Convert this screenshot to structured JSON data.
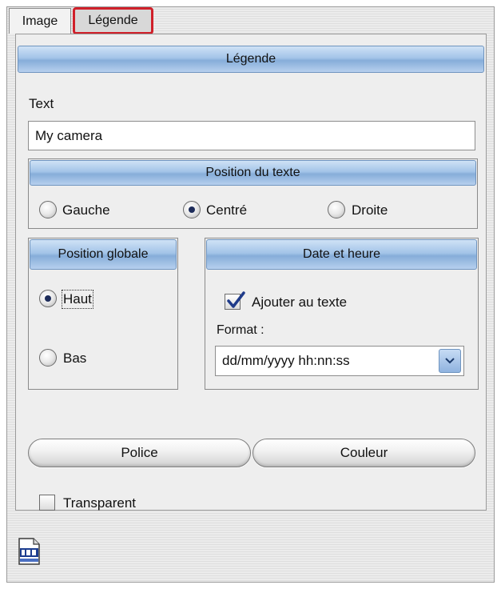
{
  "tabs": [
    {
      "label": "Image"
    },
    {
      "label": "Légende"
    }
  ],
  "legende_header": "Légende",
  "text_label": "Text",
  "text_value": "My camera",
  "position_texte": {
    "title": "Position du texte",
    "options": [
      "Gauche",
      "Centré",
      "Droite"
    ],
    "selected": "Centré"
  },
  "position_globale": {
    "title": "Position globale",
    "options": [
      "Haut",
      "Bas"
    ],
    "selected": "Haut"
  },
  "date_heure": {
    "title": "Date et heure",
    "checkbox_label": "Ajouter au texte",
    "checked": true,
    "format_label": "Format :",
    "format_value": "dd/mm/yyyy hh:nn:ss"
  },
  "buttons": {
    "police": "Police",
    "couleur": "Couleur"
  },
  "transparent_label": "Transparent",
  "transparent_checked": false,
  "icons": {
    "bottom": "jpg-file-icon",
    "dropdown": "chevron-down-icon"
  },
  "colors": {
    "accent_bar": "#a3c4e8",
    "tab_highlight": "#d0202a"
  }
}
